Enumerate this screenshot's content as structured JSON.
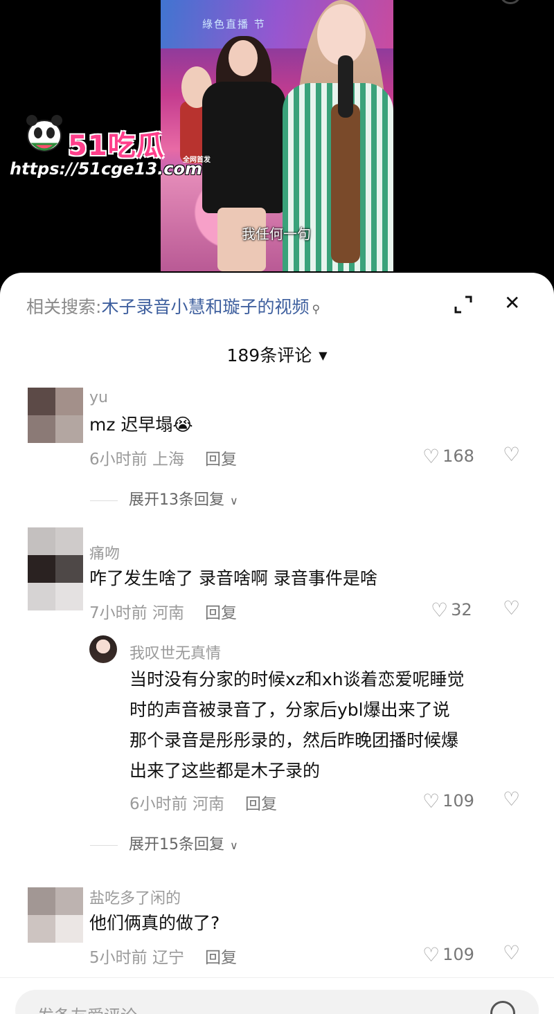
{
  "video": {
    "banner_text": "綠色直播 节",
    "subtitle": "我任何一句"
  },
  "watermark": {
    "title": "51吃瓜",
    "badge": "全网首发",
    "url": "https://51cge13.com"
  },
  "sheet": {
    "related_prefix": "相关搜索:",
    "related_keyword": "木子录音小慧和璇子的视频",
    "search_glyph": "⚲",
    "close_glyph": "✕",
    "comment_count": "189条评论",
    "dropdown_glyph": "▼"
  },
  "comments": [
    {
      "username": "yu",
      "text": "mz 迟早塌😭",
      "time": "6小时前 上海",
      "reply": "回复",
      "likes": "168",
      "expand": "展开13条回复"
    },
    {
      "username": "痛吻",
      "text": "咋了发生啥了 录音啥啊 录音事件是啥",
      "time": "7小时前 河南",
      "reply": "回复",
      "likes": "32"
    },
    {
      "username": "我叹世无真情",
      "text_lines": [
        "当时没有分家的时候xz和xh谈着恋爱呢睡觉",
        "时的声音被录音了，分家后ybl爆出来了说",
        "那个录音是彤彤录的，然后昨晚团播时候爆",
        "出来了这些都是木子录的"
      ],
      "time": "6小时前 河南",
      "reply": "回复",
      "likes": "109",
      "expand": "展开15条回复"
    },
    {
      "username": "盐吃多了闲的",
      "text": "他们俩真的做了?",
      "time": "5小时前 辽宁",
      "reply": "回复",
      "likes": "109"
    }
  ],
  "input": {
    "placeholder": "发条友爱评论"
  },
  "icons": {
    "heart": "heart-outline-icon",
    "dislike": "broken-heart-icon",
    "chevron": "chevron-down-icon"
  },
  "colors": {
    "keyword_blue": "#3e5f9e",
    "watermark_pink": "#ff3f8b"
  }
}
